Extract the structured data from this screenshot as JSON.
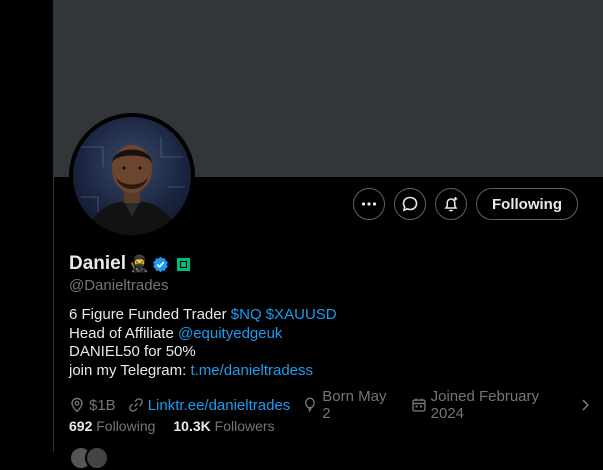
{
  "profile": {
    "name": "Daniel",
    "name_emoji": "🥷",
    "handle": "@Danieltrades",
    "bio": {
      "line1_text": "6 Figure Funded Trader",
      "line1_tag1": "$NQ",
      "line1_tag2": "$XAUUSD",
      "line2_text": "Head of Affiliate",
      "line2_mention": "@equityedgeuk",
      "line3_text": "DANIEL50 for 50%",
      "line4_text": "join my Telegram:",
      "line4_link": "t.me/danieltradess"
    },
    "meta": {
      "location": "$1B",
      "website": "Linktr.ee/danieltrades",
      "born": "Born May 2",
      "joined": "Joined February 2024"
    },
    "stats": {
      "following_count": "692",
      "following_label": "Following",
      "followers_count": "10.3K",
      "followers_label": "Followers"
    }
  },
  "actions": {
    "follow_label": "Following"
  },
  "colors": {
    "accent": "#1d9bf0",
    "verified": "#1d9bf0",
    "affiliate_badge": "#00ba7c",
    "muted": "#71767b"
  }
}
